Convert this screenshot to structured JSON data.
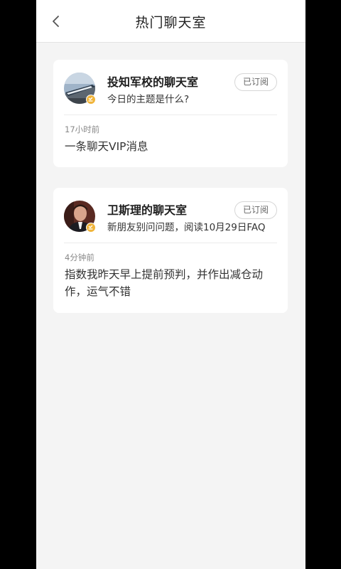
{
  "header": {
    "title": "热门聊天室",
    "back_icon": "chevron-left-icon"
  },
  "rooms": [
    {
      "name": "投知军校的聊天室",
      "topic": "今日的主题是什么?",
      "subscribe_label": "已订阅",
      "time": "17小时前",
      "message": "一条聊天VIP消息",
      "avatar": "train-avatar"
    },
    {
      "name": "卫斯理的聊天室",
      "topic": "新朋友别问问题，阅读10月29日FAQ",
      "subscribe_label": "已订阅",
      "time": "4分钟前",
      "message": "指数我昨天早上提前预判，并作出减仓动作，运气不错",
      "avatar": "person-avatar"
    }
  ],
  "colors": {
    "badge": "#f0b43a",
    "background": "#f4f4f4",
    "card": "#ffffff"
  }
}
